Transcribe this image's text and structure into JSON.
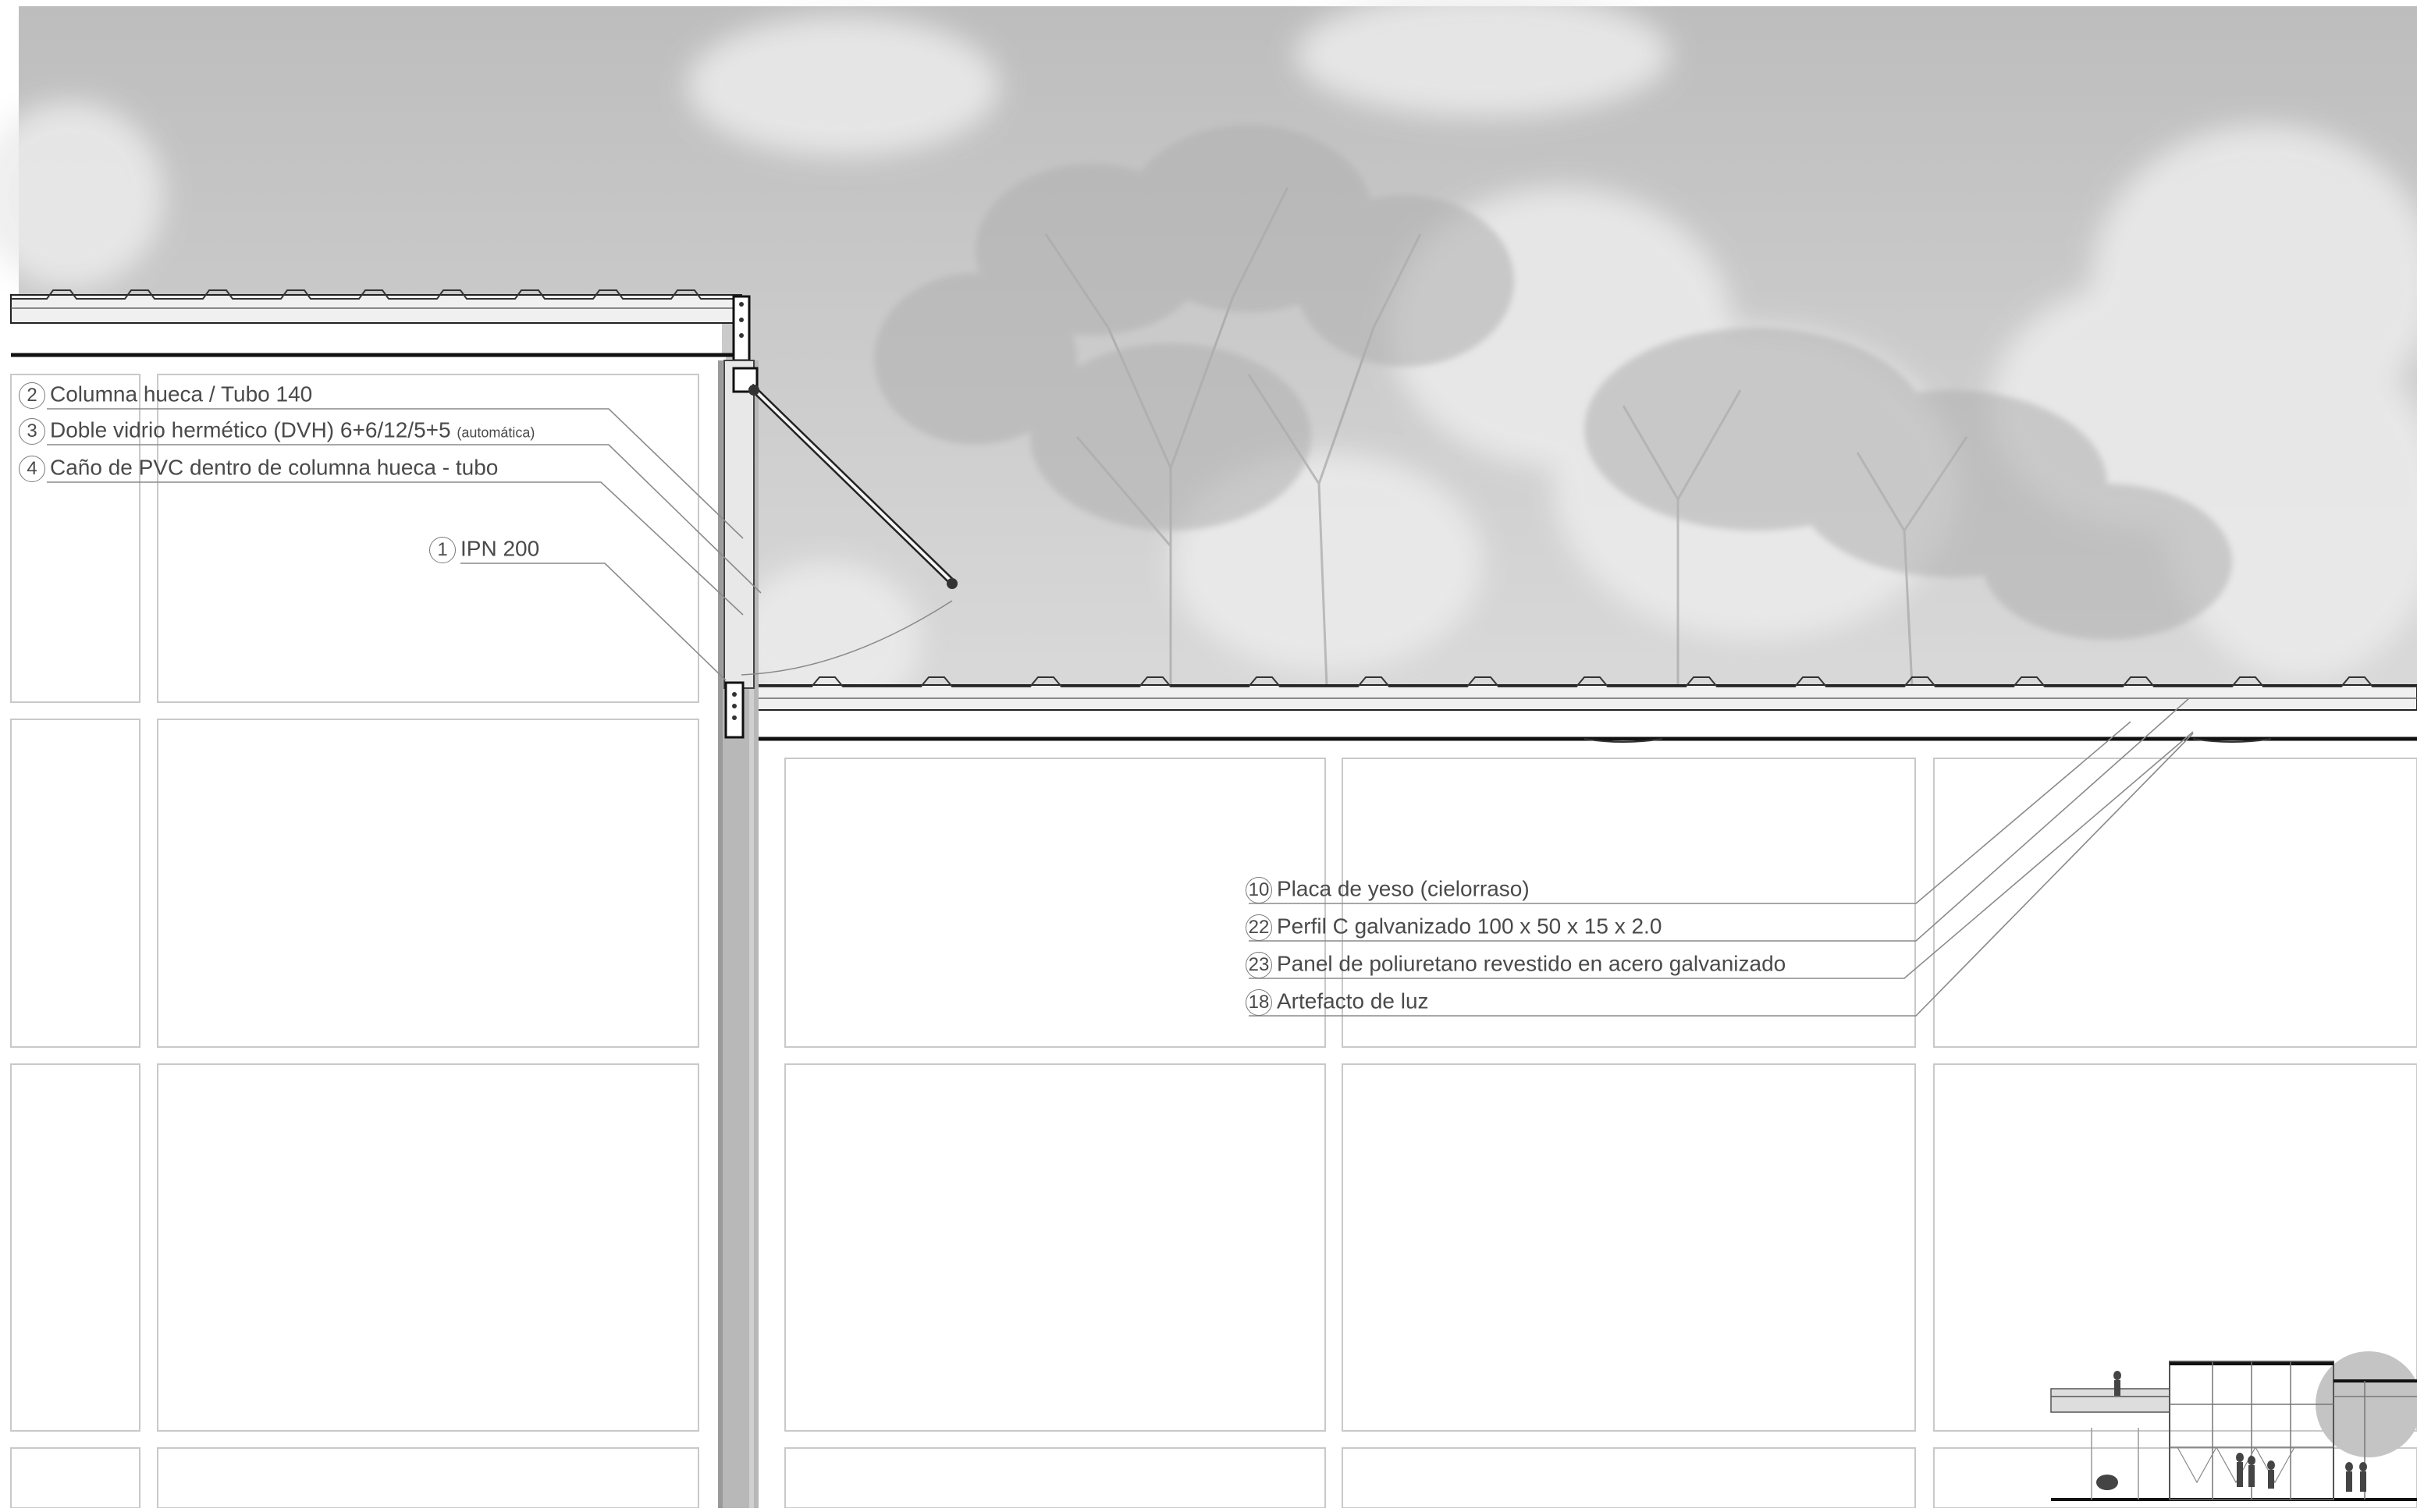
{
  "callouts": {
    "c2": {
      "num": "2",
      "text": "Columna hueca / Tubo 140"
    },
    "c3": {
      "num": "3",
      "text": "Doble vidrio hermético (DVH) 6+6/12/5+5",
      "note": "(automática)"
    },
    "c4": {
      "num": "4",
      "text": "Caño de PVC dentro de columna hueca - tubo"
    },
    "c1": {
      "num": "1",
      "text": "IPN 200"
    },
    "c10": {
      "num": "10",
      "text": "Placa de yeso (cielorraso)"
    },
    "c22": {
      "num": "22",
      "text": "Perfil C galvanizado 100 x 50 x 15 x 2.0"
    },
    "c23": {
      "num": "23",
      "text": "Panel de poliuretano revestido en acero galvanizado"
    },
    "c18": {
      "num": "18",
      "text": "Artefacto de luz"
    }
  },
  "colors": {
    "sky": "#c9c9c9",
    "cloud": "#e6e6e6",
    "tree": "#a8a8a8",
    "column": "#b5b5b5",
    "grid_line": "#c8c8c8",
    "leader": "#8a8a8a",
    "structure": "#111111"
  }
}
